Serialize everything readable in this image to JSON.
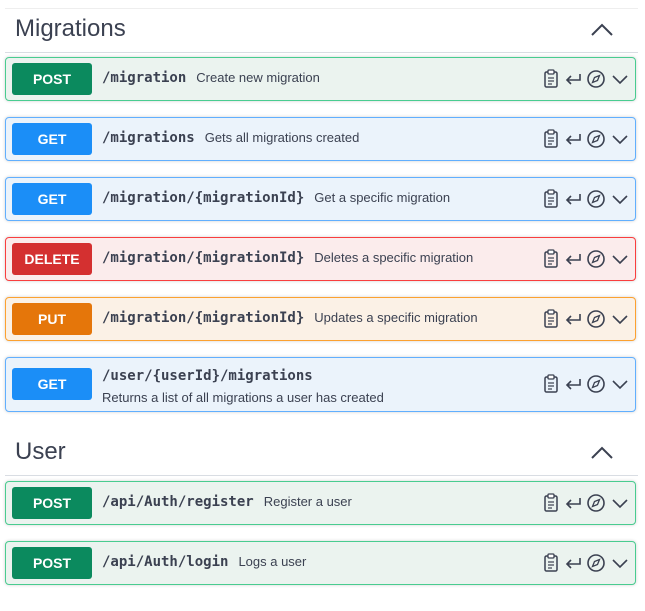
{
  "sections": [
    {
      "title": "Migrations",
      "operations": [
        {
          "method": "POST",
          "path": "/migration",
          "description": "Create new migration"
        },
        {
          "method": "GET",
          "path": "/migrations",
          "description": "Gets all migrations created"
        },
        {
          "method": "GET",
          "path": "/migration/{migrationId}",
          "description": "Get a specific migration"
        },
        {
          "method": "DELETE",
          "path": "/migration/{migrationId}",
          "description": "Deletes a specific migration"
        },
        {
          "method": "PUT",
          "path": "/migration/{migrationId}",
          "description": "Updates a specific migration"
        },
        {
          "method": "GET",
          "path": "/user/{userId}/migrations",
          "description": "Returns a list of all migrations a user has created"
        }
      ]
    },
    {
      "title": "User",
      "operations": [
        {
          "method": "POST",
          "path": "/api/Auth/register",
          "description": "Register a user"
        },
        {
          "method": "POST",
          "path": "/api/Auth/login",
          "description": "Logs a user"
        }
      ]
    }
  ],
  "icons": [
    "clipboard-icon",
    "return-arrow-icon",
    "compass-icon",
    "chevron-down-icon",
    "chevron-up-icon"
  ],
  "colors": {
    "post": "#0b8a5e",
    "get": "#1b8ef7",
    "delete": "#d43030",
    "put": "#e5760a"
  }
}
